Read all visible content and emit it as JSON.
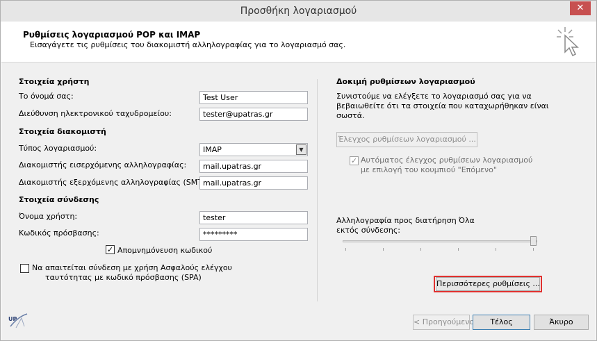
{
  "window": {
    "title": "Προσθήκη λογαριασμού",
    "close_label": "✕"
  },
  "header": {
    "title": "Ρυθμίσεις λογαριασμού POP και IMAP",
    "subtitle": "Εισαγάγετε τις ρυθμίσεις του διακομιστή αλληλογραφίας για το λογαριασμό σας."
  },
  "user_info": {
    "section": "Στοιχεία χρήστη",
    "name_label": "Το όνομά σας:",
    "name_value": "Test User",
    "email_label": "Διεύθυνση ηλεκτρονικού ταχυδρομείου:",
    "email_value": "tester@upatras.gr"
  },
  "server_info": {
    "section": "Στοιχεία διακομιστή",
    "type_label": "Τύπος λογαριασμού:",
    "type_value": "IMAP",
    "incoming_label": "Διακομιστής εισερχόμενης αλληλογραφίας:",
    "incoming_value": "mail.upatras.gr",
    "outgoing_label": "Διακομιστής εξερχόμενης αλληλογραφίας (SMTP):",
    "outgoing_value": "mail.upatras.gr"
  },
  "login_info": {
    "section": "Στοιχεία σύνδεσης",
    "username_label": "Όνομα χρήστη:",
    "username_value": "tester",
    "password_label": "Κωδικός πρόσβασης:",
    "password_value": "*********",
    "remember_label": "Απομνημόνευση κωδικού",
    "remember_checked": true,
    "spa_label_1": "Να απαιτείται σύνδεση με χρήση Ασφαλούς ελέγχου",
    "spa_label_2": "ταυτότητας με κωδικό πρόσβασης (SPA)",
    "spa_checked": false
  },
  "test_settings": {
    "section": "Δοκιμή ρυθμίσεων λογαριασμού",
    "desc_1": "Συνιστούμε να ελέγξετε το λογαριασμό σας για να",
    "desc_2": "βεβαιωθείτε ότι τα στοιχεία που καταχωρήθηκαν είναι",
    "desc_3": "σωστά.",
    "test_button": "Έλεγχος ρυθμίσεων λογαριασμού ...",
    "auto_label_1": "Αυτόματος έλεγχος ρυθμίσεων λογαριασμού",
    "auto_label_2": "με επιλογή του κουμπιού \"Επόμενο\"",
    "auto_checked": true
  },
  "offline": {
    "label_1": "Αλληλογραφία προς διατήρηση",
    "label_2": "εκτός σύνδεσης:",
    "value": "Όλα",
    "slider_fraction": 1.0
  },
  "buttons": {
    "more_settings": "Περισσότερες ρυθμίσεις ...",
    "back": "< Προηγούμενο",
    "finish": "Τέλος",
    "cancel": "Άκυρο"
  },
  "logo_text": "UP",
  "colors": {
    "highlight": "#e0312f",
    "close": "#c75050"
  }
}
